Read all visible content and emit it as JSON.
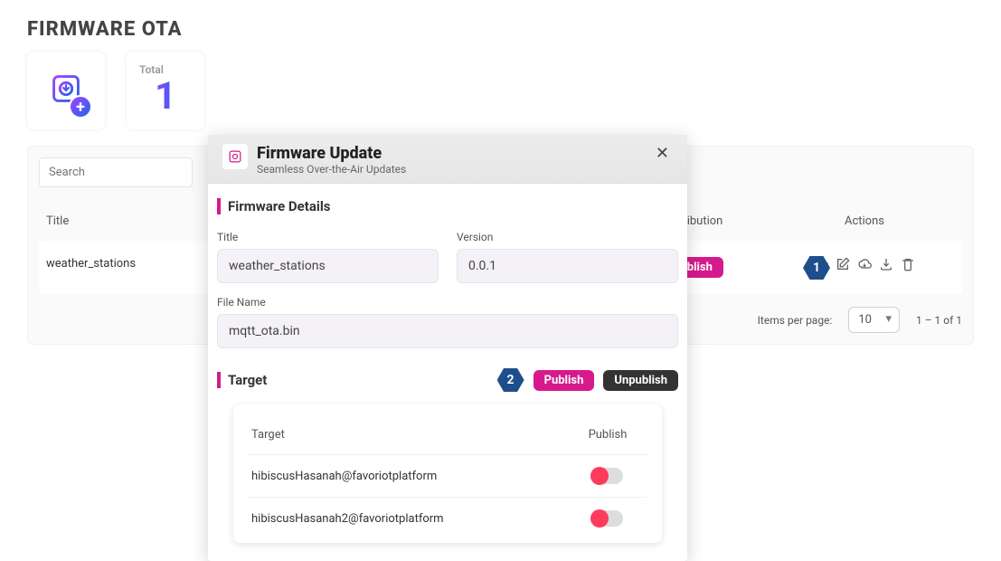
{
  "page": {
    "title": "FIRMWARE OTA"
  },
  "summary": {
    "total_label": "Total",
    "total_value": "1"
  },
  "search": {
    "placeholder": "Search"
  },
  "table": {
    "headers": {
      "title": "Title",
      "distribution": "Distribution",
      "actions": "Actions"
    },
    "row": {
      "title": "weather_stations",
      "dist_label": "Publish"
    }
  },
  "pager": {
    "items_label": "Items per page:",
    "per_page": "10",
    "range": "1 – 1 of 1"
  },
  "modal": {
    "title": "Firmware Update",
    "subtitle": "Seamless Over-the-Air Updates",
    "section_details": "Firmware Details",
    "title_label": "Title",
    "title_value": "weather_stations",
    "version_label": "Version",
    "version_value": "0.0.1",
    "filename_label": "File Name",
    "filename_value": "mqtt_ota.bin",
    "section_target": "Target",
    "publish_label": "Publish",
    "unpublish_label": "Unpublish",
    "inner": {
      "head_target": "Target",
      "head_publish": "Publish",
      "rows": [
        {
          "target": "hibiscusHasanah@favoriotplatform"
        },
        {
          "target": "hibiscusHasanah2@favoriotplatform"
        }
      ]
    }
  },
  "callouts": {
    "one": "1",
    "two": "2"
  },
  "icons": {
    "chip": "chip-icon",
    "plus": "plus-icon",
    "close": "close-icon",
    "eye": "eye-icon",
    "edit": "edit-icon",
    "cloud": "cloud-down-icon",
    "download": "download-icon",
    "trash": "trash-icon"
  }
}
